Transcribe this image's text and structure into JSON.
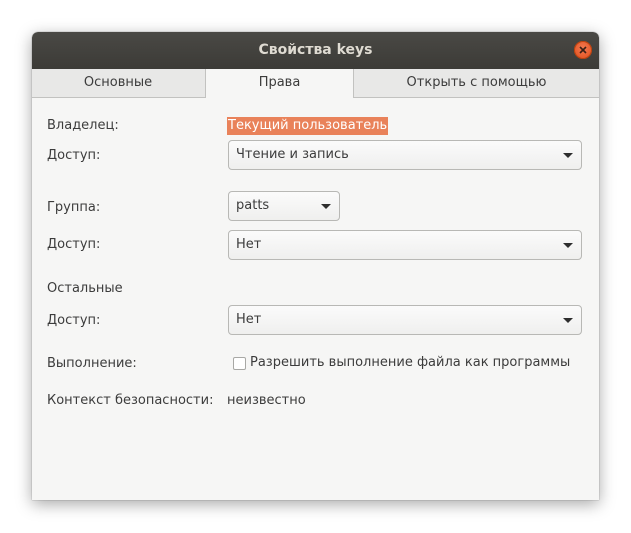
{
  "window": {
    "title": "Свойства keys"
  },
  "tabs": [
    {
      "label": "Основные",
      "active": false
    },
    {
      "label": "Права",
      "active": true
    },
    {
      "label": "Открыть с помощью",
      "active": false
    }
  ],
  "owner": {
    "label": "Владелец:",
    "value": "Текущий пользователь",
    "access_label": "Доступ:",
    "access_value": "Чтение и запись"
  },
  "group": {
    "label": "Группа:",
    "value": "patts",
    "access_label": "Доступ:",
    "access_value": "Нет"
  },
  "others": {
    "heading": "Остальные",
    "access_label": "Доступ:",
    "access_value": "Нет"
  },
  "execute": {
    "label": "Выполнение:",
    "checkbox_label": "Разрешить выполнение файла как программы",
    "checked": false
  },
  "security": {
    "label": "Контекст безопасности:",
    "value": "неизвестно"
  },
  "colors": {
    "titlebar": "#3c3b37",
    "close_button": "#e5531a",
    "selection_highlight": "#e9825a",
    "window_background": "#f6f6f5"
  },
  "icons": {
    "close": "close-icon",
    "dropdown": "chevron-down-icon"
  }
}
